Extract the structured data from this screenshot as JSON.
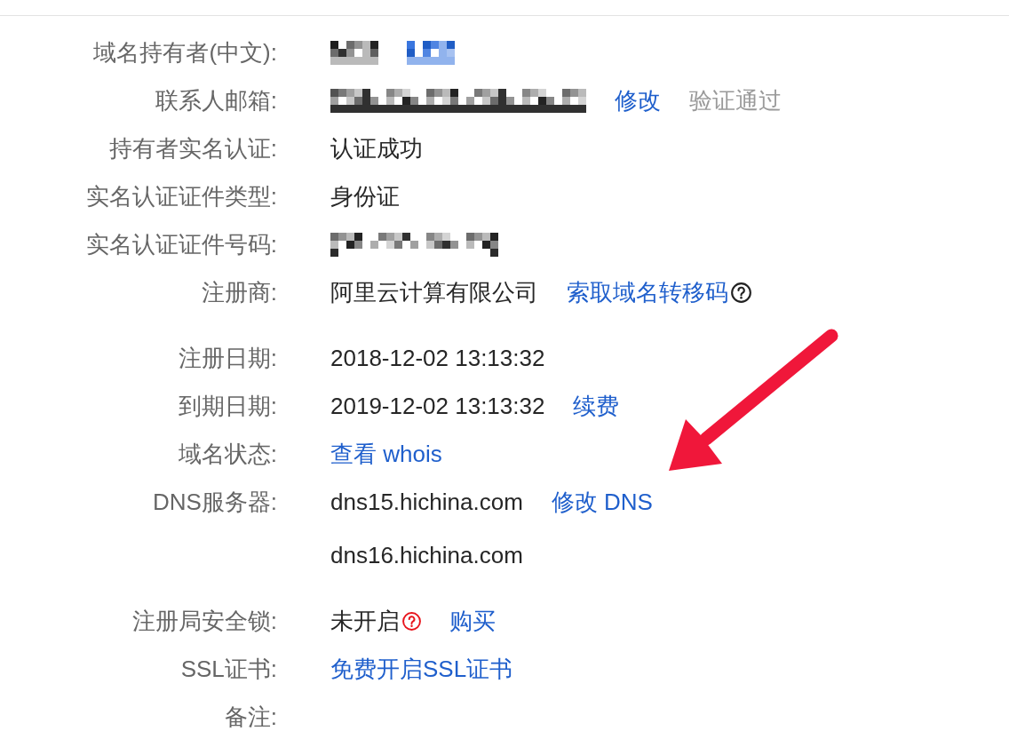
{
  "sections": [
    {
      "rows": [
        {
          "label": "域名持有者(中文):",
          "lines": [
            {
              "items": [
                {
                  "kind": "redacted"
                },
                {
                  "kind": "redacted_link"
                }
              ]
            }
          ]
        },
        {
          "label": "联系人邮箱:",
          "lines": [
            {
              "items": [
                {
                  "kind": "redacted"
                },
                {
                  "kind": "link",
                  "text": "修改"
                },
                {
                  "kind": "muted",
                  "text": "验证通过"
                }
              ]
            }
          ]
        },
        {
          "label": "持有者实名认证:",
          "lines": [
            {
              "items": [
                {
                  "kind": "text",
                  "text": "认证成功"
                }
              ]
            }
          ]
        },
        {
          "label": "实名认证证件类型:",
          "lines": [
            {
              "items": [
                {
                  "kind": "text",
                  "text": "身份证"
                }
              ]
            }
          ]
        },
        {
          "label": "实名认证证件号码:",
          "lines": [
            {
              "items": [
                {
                  "kind": "redacted"
                }
              ]
            }
          ]
        },
        {
          "label": "注册商:",
          "lines": [
            {
              "items": [
                {
                  "kind": "text",
                  "text": "阿里云计算有限公司"
                },
                {
                  "kind": "link",
                  "text": "索取域名转移码"
                },
                {
                  "kind": "help"
                }
              ]
            }
          ]
        }
      ]
    },
    {
      "rows": [
        {
          "label": "注册日期:",
          "lines": [
            {
              "items": [
                {
                  "kind": "text",
                  "text": "2018-12-02 13:13:32"
                }
              ]
            }
          ]
        },
        {
          "label": "到期日期:",
          "lines": [
            {
              "items": [
                {
                  "kind": "text",
                  "text": "2019-12-02 13:13:32"
                },
                {
                  "kind": "link",
                  "text": "续费"
                }
              ]
            }
          ]
        },
        {
          "label": "域名状态:",
          "lines": [
            {
              "items": [
                {
                  "kind": "link",
                  "text": "查看 whois"
                }
              ]
            }
          ]
        },
        {
          "label": "DNS服务器:",
          "lines": [
            {
              "items": [
                {
                  "kind": "text",
                  "text": "dns15.hichina.com"
                },
                {
                  "kind": "link",
                  "text": "修改 DNS"
                }
              ]
            },
            {
              "items": [
                {
                  "kind": "text",
                  "text": "dns16.hichina.com"
                }
              ]
            }
          ]
        }
      ]
    },
    {
      "rows": [
        {
          "label": "注册局安全锁:",
          "lines": [
            {
              "items": [
                {
                  "kind": "text",
                  "text": "未开启"
                },
                {
                  "kind": "alert_help"
                },
                {
                  "kind": "link",
                  "text": "购买"
                }
              ]
            }
          ]
        },
        {
          "label": "SSL证书:",
          "lines": [
            {
              "items": [
                {
                  "kind": "link",
                  "text": "免费开启SSL证书"
                }
              ]
            }
          ]
        },
        {
          "label": "备注:",
          "lines": []
        }
      ]
    }
  ]
}
